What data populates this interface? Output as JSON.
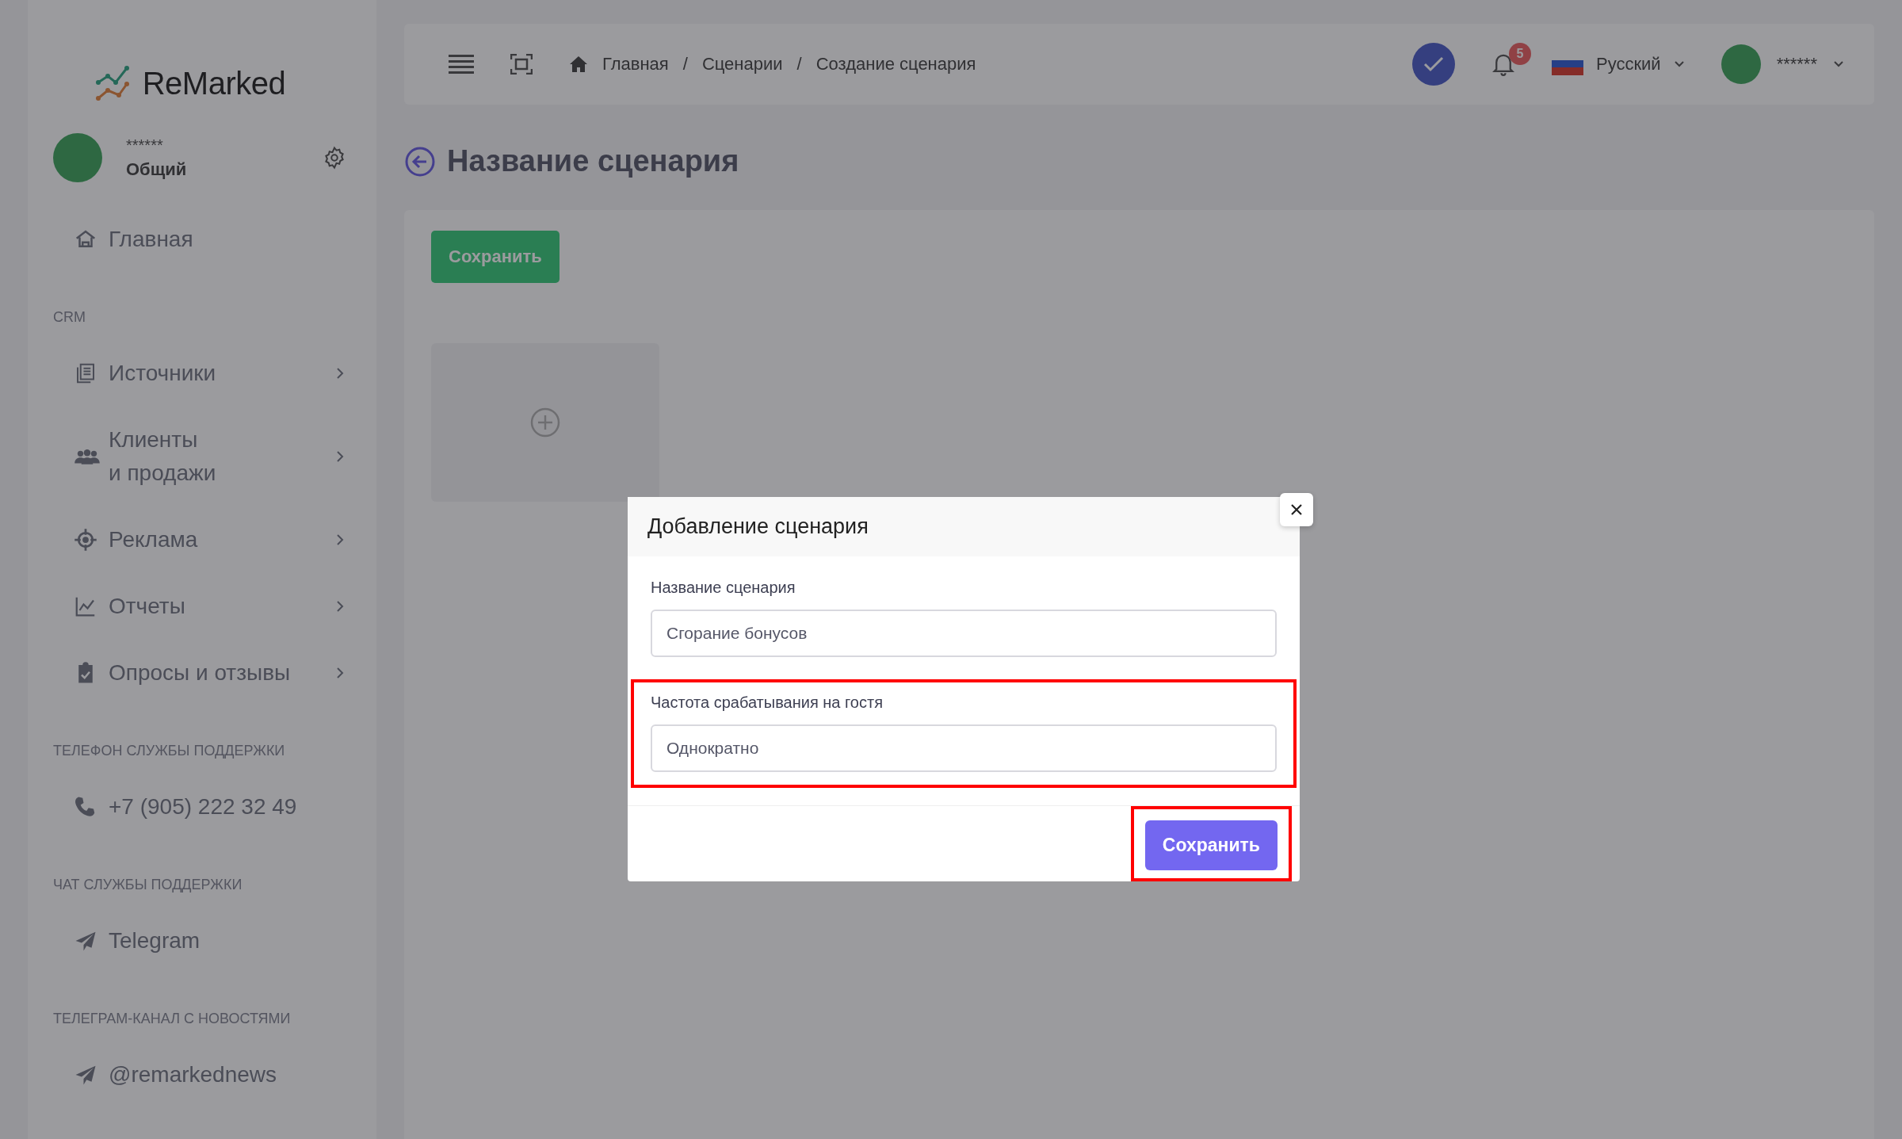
{
  "brand": {
    "name": "ReMarked"
  },
  "account": {
    "name": "******",
    "role": "Общий"
  },
  "sidebar": {
    "entries": [
      {
        "kind": "link",
        "label": "Главная"
      },
      {
        "kind": "heading",
        "label": "CRM"
      },
      {
        "kind": "menu",
        "label": "Источники"
      },
      {
        "kind": "menu",
        "label": "Клиенты\nи продажи"
      },
      {
        "kind": "menu",
        "label": "Реклама"
      },
      {
        "kind": "menu",
        "label": "Отчеты"
      },
      {
        "kind": "menu",
        "label": "Опросы и отзывы"
      },
      {
        "kind": "heading",
        "label": "ТЕЛЕФОН СЛУЖБЫ ПОДДЕРЖКИ"
      },
      {
        "kind": "link",
        "label": "+7 (905) 222 32 49"
      },
      {
        "kind": "heading",
        "label": "ЧАТ СЛУЖБЫ ПОДДЕРЖКИ"
      },
      {
        "kind": "link",
        "label": "Telegram"
      },
      {
        "kind": "heading",
        "label": "ТЕЛЕГРАМ-КАНАЛ С НОВОСТЯМИ"
      },
      {
        "kind": "link",
        "label": "@remarkednews"
      }
    ]
  },
  "header": {
    "breadcrumbs": [
      "Главная",
      "Сценарии",
      "Создание сценария"
    ],
    "breadcrumb_separator": "/",
    "notifications": "5",
    "language": "Русский",
    "user": "******"
  },
  "page": {
    "title": "Название сценария",
    "save_button": "Сохранить"
  },
  "modal": {
    "title": "Добавление сценария",
    "fields": [
      {
        "label": "Название сценария",
        "value": "Сгорание бонусов",
        "highlighted": false
      },
      {
        "label": "Частота срабатывания на гостя",
        "value": "Однократно",
        "highlighted": true
      }
    ],
    "save_button": {
      "label": "Сохранить",
      "highlighted": true
    }
  }
}
